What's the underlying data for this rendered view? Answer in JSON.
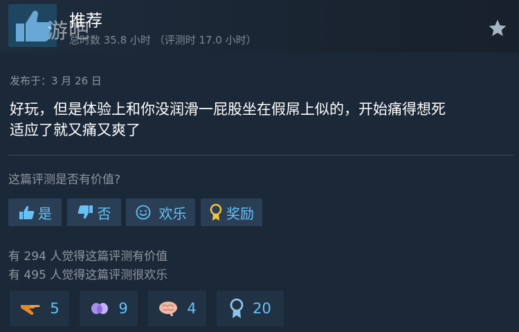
{
  "header": {
    "watermark": "游吧",
    "title": "推荐",
    "hours": "总时数 35.8 小时  （评测时 17.0 小时）"
  },
  "review": {
    "posted": "发布于：3 月 26 日",
    "line1": "好玩，但是体验上和你没润滑一屁股坐在假屌上似的，开始痛得想死",
    "line2": "适应了就又痛又爽了"
  },
  "helpful": {
    "question": "这篇评测是否有价值?",
    "yes_label": "是",
    "no_label": "否",
    "funny_label": "欢乐",
    "award_label": "奖励"
  },
  "stats": {
    "helpful_line": "有 294 人觉得这篇评测有价值",
    "funny_line": "有 495 人觉得这篇评测很欢乐"
  },
  "awards": [
    {
      "icon": "pointing-hand-icon",
      "count": "5"
    },
    {
      "icon": "heart-hands-icon",
      "count": "9"
    },
    {
      "icon": "brain-icon",
      "count": "4"
    },
    {
      "icon": "medal-ribbon-icon",
      "count": "20"
    }
  ],
  "colors": {
    "background": "#1b2838",
    "accent": "#67c1f5",
    "button_bg": "#2a3f55",
    "award_orange": "#e8891f",
    "award_purple": "#a98ef0"
  }
}
